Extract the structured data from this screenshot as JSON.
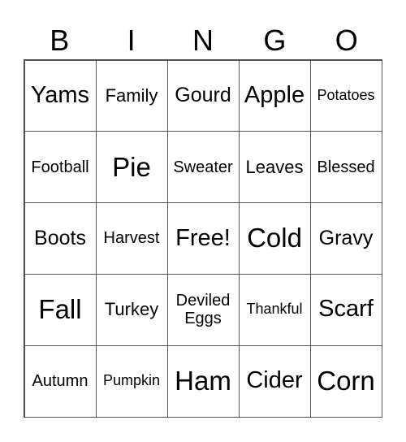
{
  "title_letters": [
    "B",
    "I",
    "N",
    "G",
    "O"
  ],
  "cells": [
    [
      "Yams",
      "Family",
      "Gourd",
      "Apple",
      "Potatoes"
    ],
    [
      "Football",
      "Pie",
      "Sweater",
      "Leaves",
      "Blessed"
    ],
    [
      "Boots",
      "Harvest",
      "Free!",
      "Cold",
      "Gravy"
    ],
    [
      "Fall",
      "Turkey",
      "Deviled Eggs",
      "Thankful",
      "Scarf"
    ],
    [
      "Autumn",
      "Pumpkin",
      "Ham",
      "Cider",
      "Corn"
    ]
  ]
}
